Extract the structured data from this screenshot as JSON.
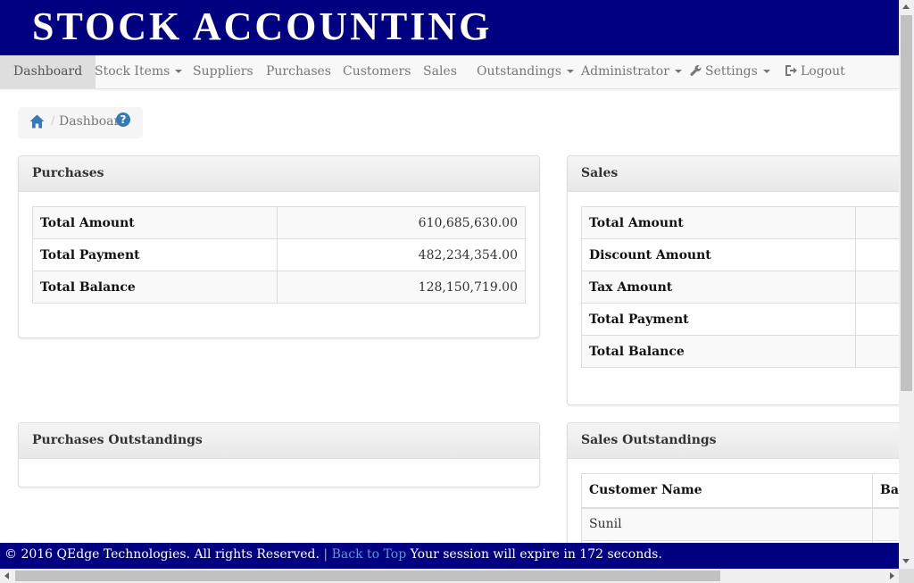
{
  "app": {
    "title": "STOCK ACCOUNTING"
  },
  "nav": {
    "dashboard": "Dashboard",
    "stock_items": "Stock Items",
    "suppliers": "Suppliers",
    "purchases": "Purchases",
    "customers": "Customers",
    "sales": "Sales",
    "outstandings": "Outstandings",
    "administrator": "Administrator",
    "settings": "Settings",
    "logout": "Logout"
  },
  "breadcrumb": {
    "current": "Dashboard",
    "help_icon": "?"
  },
  "purchases_panel": {
    "title": "Purchases",
    "rows": [
      {
        "label": "Total Amount",
        "value": "610,685,630.00"
      },
      {
        "label": "Total Payment",
        "value": "482,234,354.00"
      },
      {
        "label": "Total Balance",
        "value": "128,150,719.00"
      }
    ]
  },
  "sales_panel": {
    "title": "Sales",
    "rows": [
      {
        "label": "Total Amount"
      },
      {
        "label": "Discount Amount"
      },
      {
        "label": "Tax Amount"
      },
      {
        "label": "Total Payment"
      },
      {
        "label": "Total Balance"
      }
    ]
  },
  "purchases_outstandings": {
    "title": "Purchases Outstandings"
  },
  "sales_outstandings": {
    "title": "Sales Outstandings",
    "columns": [
      "Customer Name",
      "Bal"
    ],
    "rows": [
      {
        "customer": "Sunil"
      }
    ]
  },
  "footer": {
    "copyright": "© 2016 QEdge Technologies. All rights Reserved.",
    "separator": "|",
    "back_to_top": "Back to Top",
    "session": "Your session will expire in 172 seconds."
  },
  "icons": {
    "home": "home-icon",
    "help": "question-circle-icon",
    "settings": "wrench-icon",
    "logout": "sign-out-icon",
    "dropdown": "caret-down-icon"
  },
  "colors": {
    "brand": "#000080",
    "link": "#337ab7"
  }
}
